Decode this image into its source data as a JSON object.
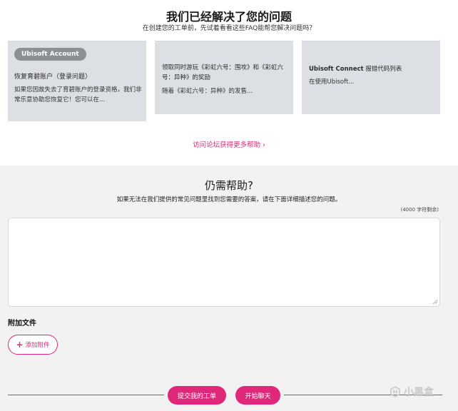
{
  "faq": {
    "title": "我们已经解决了您的问题",
    "subtitle": "在创建您的工单前，先试着看看这些FAQ能帮您解决问题吗？",
    "cards": [
      {
        "badge": "Ubisoft Account",
        "title": "恢复育碧账户（登录问题）",
        "body": "如果您因故失去了育碧账户的登录资格，我们非常乐意协助您恢复它！您可以在..."
      },
      {
        "title": "领取同时游玩《彩虹六号：围攻》和《彩虹六号：异种》的奖励",
        "body": "随着《彩虹六号：异种》的发售..."
      },
      {
        "title_bold": "Ubisoft Connect",
        "title_rest": " 报错代码列表",
        "body": "在使用Ubisoft..."
      }
    ],
    "forum_link": "访问论坛获得更多帮助 ›"
  },
  "help": {
    "title": "仍需帮助?",
    "subtitle": "如果无法在我们提供的常见问题里找到您需要的答案，请在下面详细描述您的问题。",
    "char_count": "(4000 字符剩余)",
    "textarea_value": "",
    "attach_label": "附加文件",
    "add_attachment": "添加附件",
    "submit_label": "提交我的工单",
    "chat_label": "开始聊天"
  },
  "watermark": {
    "text": "小黑盒",
    "icon": "heybox-logo-icon"
  },
  "colors": {
    "accent": "#e0287a",
    "card_bg": "#dcdfe3",
    "section_bg": "#f2f2f2",
    "badge_bg": "#8c8f94"
  }
}
